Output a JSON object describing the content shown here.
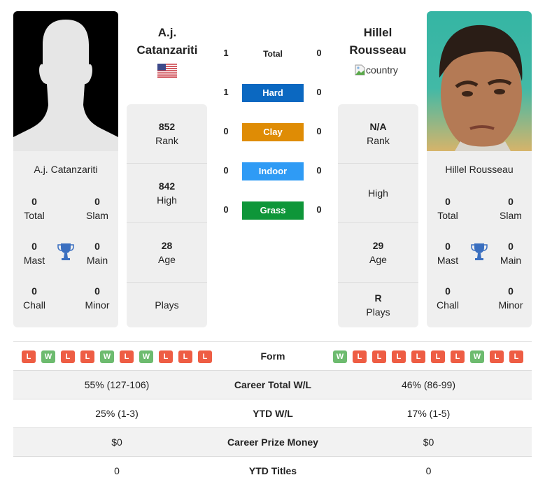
{
  "player_left": {
    "name_line1": "A.j.",
    "name_line2": "Catanzariti",
    "full_name": "A.j. Catanzariti",
    "country_flag": "us-flag",
    "titles": {
      "total": "0",
      "total_label": "Total",
      "slam": "0",
      "slam_label": "Slam",
      "mast": "0",
      "mast_label": "Mast",
      "main": "0",
      "main_label": "Main",
      "chall": "0",
      "chall_label": "Chall",
      "minor": "0",
      "minor_label": "Minor"
    },
    "stats": [
      {
        "value": "852",
        "label": "Rank"
      },
      {
        "value": "842",
        "label": "High"
      },
      {
        "value": "28",
        "label": "Age"
      },
      {
        "value": "",
        "label": "Plays"
      }
    ]
  },
  "player_right": {
    "name_line1": "Hillel",
    "name_line2": "Rousseau",
    "full_name": "Hillel Rousseau",
    "country_alt": "country",
    "titles": {
      "total": "0",
      "total_label": "Total",
      "slam": "0",
      "slam_label": "Slam",
      "mast": "0",
      "mast_label": "Mast",
      "main": "0",
      "main_label": "Main",
      "chall": "0",
      "chall_label": "Chall",
      "minor": "0",
      "minor_label": "Minor"
    },
    "stats": [
      {
        "value": "N/A",
        "label": "Rank"
      },
      {
        "value": "",
        "label": "High"
      },
      {
        "value": "29",
        "label": "Age"
      },
      {
        "value": "R",
        "label": "Plays"
      }
    ]
  },
  "h2h": [
    {
      "label": "Total",
      "left": "1",
      "right": "0",
      "color": null
    },
    {
      "label": "Hard",
      "left": "1",
      "right": "0",
      "color": "#0b68c1"
    },
    {
      "label": "Clay",
      "left": "0",
      "right": "0",
      "color": "#df8c05"
    },
    {
      "label": "Indoor",
      "left": "0",
      "right": "0",
      "color": "#2f9bf5"
    },
    {
      "label": "Grass",
      "left": "0",
      "right": "0",
      "color": "#0e9639"
    }
  ],
  "comparison": {
    "form_label": "Form",
    "form_left": [
      "L",
      "W",
      "L",
      "L",
      "W",
      "L",
      "W",
      "L",
      "L",
      "L"
    ],
    "form_right": [
      "W",
      "L",
      "L",
      "L",
      "L",
      "L",
      "L",
      "W",
      "L",
      "L"
    ],
    "rows": [
      {
        "label": "Career Total W/L",
        "left": "55% (127-106)",
        "right": "46% (86-99)"
      },
      {
        "label": "YTD W/L",
        "left": "25% (1-3)",
        "right": "17% (1-5)"
      },
      {
        "label": "Career Prize Money",
        "left": "$0",
        "right": "$0"
      },
      {
        "label": "YTD Titles",
        "left": "0",
        "right": "0"
      }
    ]
  }
}
